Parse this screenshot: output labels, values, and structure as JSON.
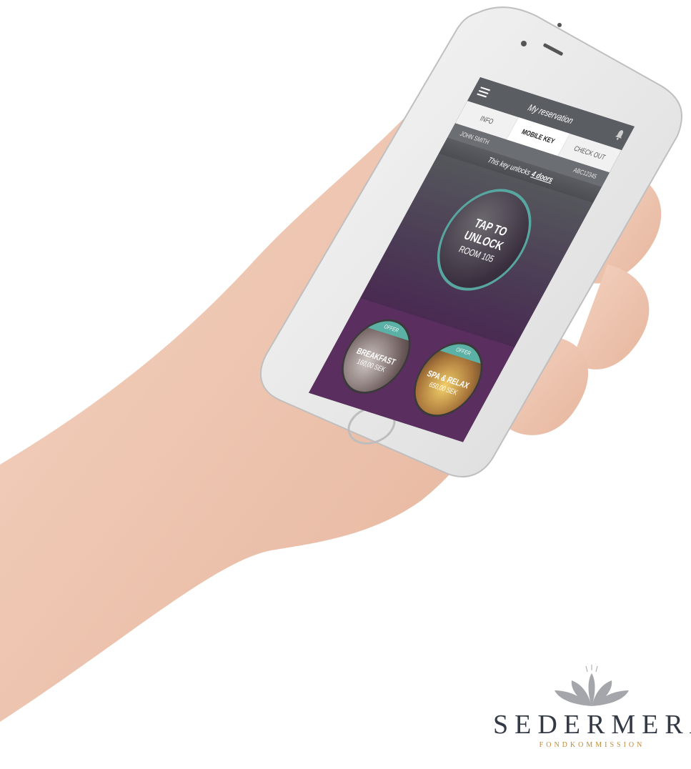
{
  "app": {
    "title": "My reservation",
    "tabs": [
      {
        "label": "INFO",
        "active": false
      },
      {
        "label": "MOBILE KEY",
        "active": true
      },
      {
        "label": "CHECK OUT",
        "active": false
      }
    ],
    "guest_name": "JOHN SMITH",
    "reservation_code": "ABC12345",
    "doors_text": "This key unlocks",
    "doors_link": "4 doors",
    "unlock": {
      "line1": "TAP TO",
      "line2": "UNLOCK",
      "line3": "ROOM 105"
    },
    "offers": [
      {
        "badge": "OFFER",
        "title": "BREAKFAST",
        "price": "160,00 SEK"
      },
      {
        "badge": "OFFER",
        "title": "SPA & RELAX",
        "price": "650,00 SEK"
      }
    ]
  },
  "branding": {
    "name": "SEDERMERA",
    "subtitle": "FONDKOMMISSION"
  },
  "colors": {
    "accent": "#58a6a0",
    "topbar": "#5a5d62",
    "purple": "#5a2e5e",
    "logo_text": "#333a46",
    "logo_sub": "#c08b3b"
  },
  "icons": [
    "menu-icon",
    "bell-icon",
    "lotus-logo-icon"
  ]
}
